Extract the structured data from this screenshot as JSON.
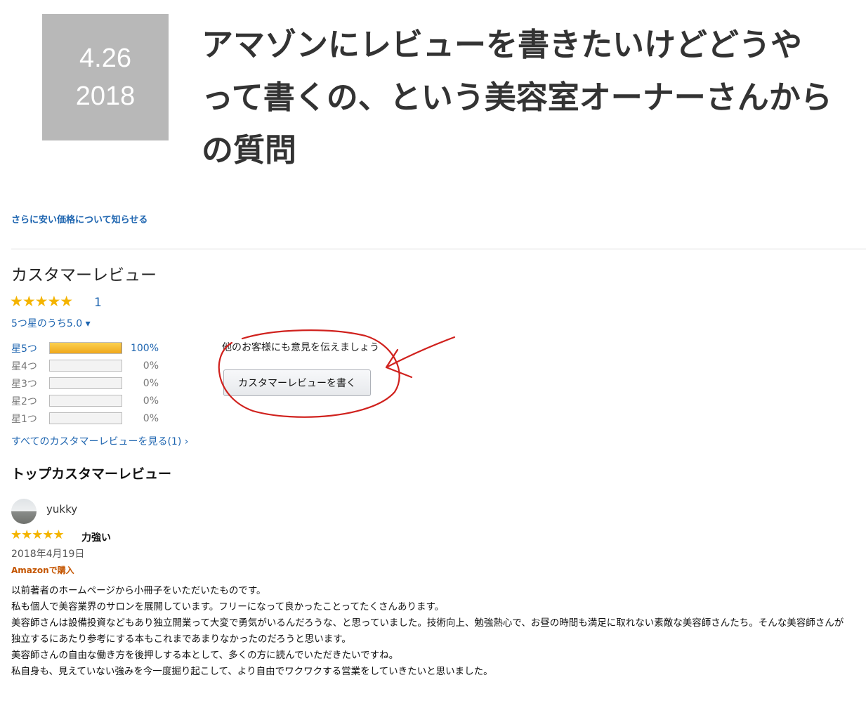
{
  "post": {
    "date_day": "4.26",
    "date_year": "2018",
    "title": "アマゾンにレビューを書きたいけどどうやって書くの、という美容室オーナーさんからの質問"
  },
  "amazon": {
    "price_alert_link": "さらに安い価格について知らせる",
    "customer_reviews_heading": "カスタマーレビュー",
    "overall_stars": "★★★★★",
    "review_count": "1",
    "average_rating": "5つ星のうち5.0 ▾",
    "histogram": [
      {
        "label": "星5つ",
        "percent_text": "100%",
        "fraction": 1.0
      },
      {
        "label": "星4つ",
        "percent_text": "0%",
        "fraction": 0
      },
      {
        "label": "星3つ",
        "percent_text": "0%",
        "fraction": 0
      },
      {
        "label": "星2つ",
        "percent_text": "0%",
        "fraction": 0
      },
      {
        "label": "星1つ",
        "percent_text": "0%",
        "fraction": 0
      }
    ],
    "share_prompt": "他のお客様にも意見を伝えましょう",
    "write_review_button": "カスタマーレビューを書く",
    "see_all_link": "すべてのカスタマーレビューを見る(1) ›",
    "top_reviews_heading": "トップカスタマーレビュー",
    "review": {
      "username": "yukky",
      "stars": "★★★★★",
      "title": "力強い",
      "date": "2018年4月19日",
      "verified": "Amazonで購入",
      "body": [
        "以前著者のホームページから小冊子をいただいたものです。",
        "私も個人で美容業界のサロンを展開しています。フリーになって良かったことってたくさんあります。",
        "美容師さんは設備投資などもあり独立開業って大変で勇気がいるんだろうな、と思っていました。技術向上、勉強熱心で、お昼の時間も満足に取れない素敵な美容師さんたち。そんな美容師さんが独立するにあたり参考にする本もこれまであまりなかったのだろうと思います。",
        "美容師さんの自由な働き方を後押しする本として、多くの方に読んでいただきたいですね。",
        "私自身も、見えていない強みを今一度掘り起こして、より自由でワクワクする営業をしていきたいと思いました。"
      ]
    },
    "colors": {
      "link": "#1e65b0",
      "star": "#f4b400",
      "bar_fill": "#f0a81c",
      "verified": "#c45500",
      "annotation": "#d0211d",
      "date_box": "#b8b8b8"
    }
  }
}
